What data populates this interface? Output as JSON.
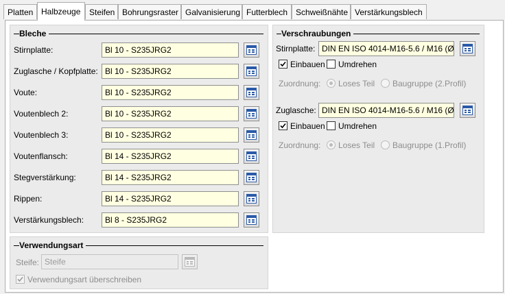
{
  "tabs": [
    "Platten",
    "Halbzeuge",
    "Steifen",
    "Bohrungsraster",
    "Galvanisierung",
    "Futterblech",
    "Schweißnähte",
    "Verstärkungsblech"
  ],
  "active_tab": "Halbzeuge",
  "bleche": {
    "title": "Bleche",
    "rows": [
      {
        "label": "Stirnplatte:",
        "value": "Bl 10 - S235JRG2"
      },
      {
        "label": "Zuglasche / Kopfplatte:",
        "value": "Bl 10 - S235JRG2"
      },
      {
        "label": "Voute:",
        "value": "Bl 10 - S235JRG2"
      },
      {
        "label": "Voutenblech 2:",
        "value": "Bl 10 - S235JRG2"
      },
      {
        "label": "Voutenblech 3:",
        "value": "Bl 10 - S235JRG2"
      },
      {
        "label": "Voutenflansch:",
        "value": "Bl 14 - S235JRG2"
      },
      {
        "label": "Stegverstärkung:",
        "value": "Bl 14 - S235JRG2"
      },
      {
        "label": "Rippen:",
        "value": "Bl 14 - S235JRG2"
      },
      {
        "label": "Verstärkungsblech:",
        "value": "Bl 8 - S235JRG2"
      }
    ]
  },
  "verschraubungen": {
    "title": "Verschraubungen",
    "groups": [
      {
        "label": "Stirnplatte:",
        "value": "DIN EN ISO 4014-M16-5.6 / M16 (Ø",
        "einbauen_label": "Einbauen",
        "einbauen_checked": true,
        "umdrehen_label": "Umdrehen",
        "umdrehen_checked": false,
        "zuordnung_label": "Zuordnung:",
        "option1": "Loses Teil",
        "option2": "Baugruppe (2.Profil)",
        "selected": "Loses Teil"
      },
      {
        "label": "Zuglasche:",
        "value": "DIN EN ISO 4014-M16-5.6 / M16 (Ø",
        "einbauen_label": "Einbauen",
        "einbauen_checked": true,
        "umdrehen_label": "Umdrehen",
        "umdrehen_checked": false,
        "zuordnung_label": "Zuordnung:",
        "option1": "Loses Teil",
        "option2": "Baugruppe (1.Profil)",
        "selected": "Loses Teil"
      }
    ]
  },
  "verwendungsart": {
    "title": "Verwendungsart",
    "label": "Steife:",
    "placeholder": "Steife",
    "override_label": "Verwendungsart überschreiben",
    "override_checked": true
  },
  "icons": {
    "picker": "catalog-picker-icon",
    "check": "checkmark-icon"
  },
  "colors": {
    "field_bg": "#ffffe1",
    "panel_bg": "#ebebeb",
    "picker_blue": "#2a5aa8"
  }
}
